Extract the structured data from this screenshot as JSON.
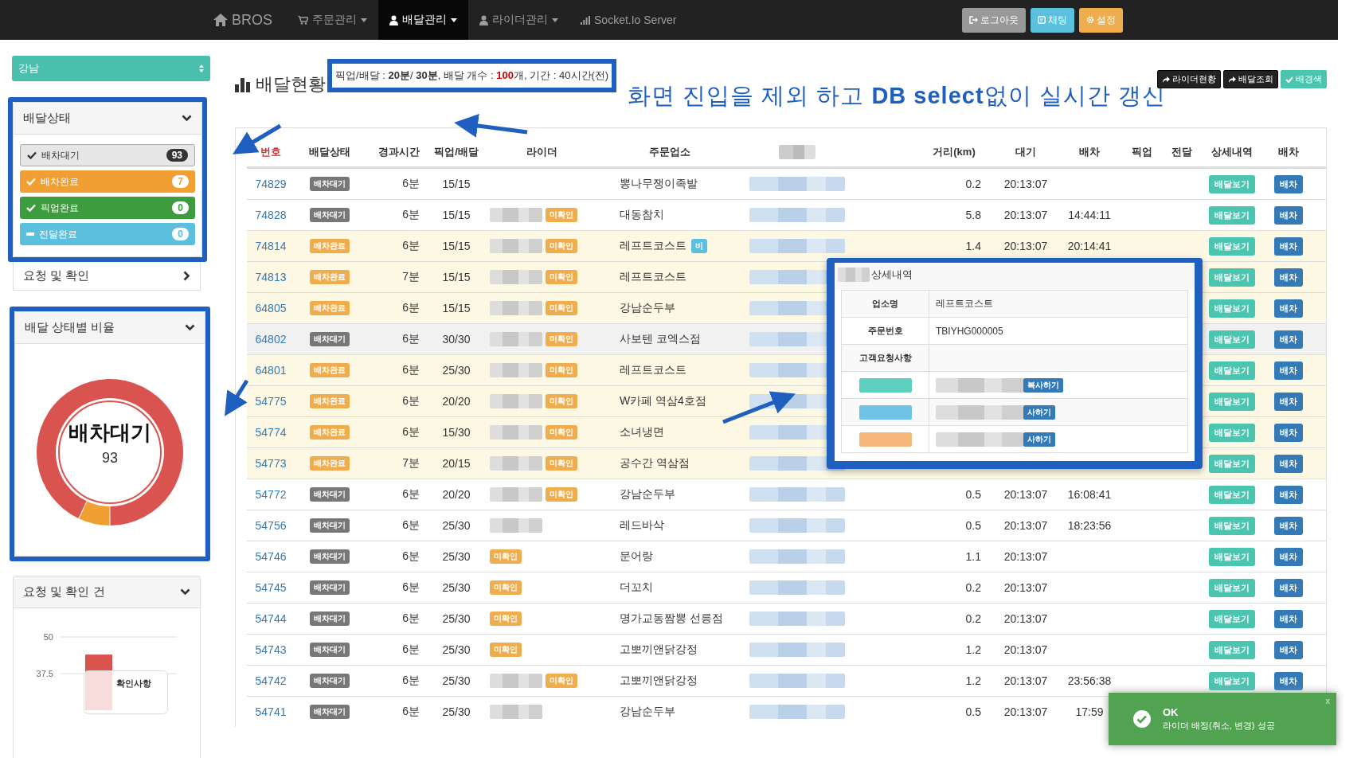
{
  "nav": {
    "brand": "BROS",
    "menus": [
      {
        "label": "주문관리",
        "kind": "orders",
        "dropdown": true,
        "selected": false
      },
      {
        "label": "배달관리",
        "kind": "delivery",
        "dropdown": true,
        "selected": true
      },
      {
        "label": "라이더관리",
        "kind": "riders",
        "dropdown": true,
        "selected": false
      },
      {
        "label": "Socket.Io Server",
        "kind": "socket",
        "dropdown": false,
        "selected": false
      }
    ],
    "buttons": [
      {
        "label": "로그아웃",
        "kind": "logout"
      },
      {
        "label": "채팅",
        "kind": "chat"
      },
      {
        "label": "설정",
        "kind": "settings"
      }
    ]
  },
  "sidebar": {
    "region": "강남",
    "status_panel": {
      "title": "배달상태",
      "expanded": true,
      "items": [
        {
          "label": "배차대기",
          "count": "93",
          "checked": true,
          "color": "#e6e6e6"
        },
        {
          "label": "배차완료",
          "count": "7",
          "checked": true,
          "color": "#f0a033"
        },
        {
          "label": "픽업완료",
          "count": "0",
          "checked": true,
          "color": "#3d9c3d"
        },
        {
          "label": "전달완료",
          "count": "0",
          "checked": false,
          "color": "#5bc0de"
        }
      ]
    },
    "request_row": {
      "title": "요청 및 확인",
      "expanded": false
    },
    "ratio_panel": {
      "title": "배달 상태별 비율",
      "expanded": true,
      "center_label": "배차대기",
      "center_value": "93",
      "chart_data": {
        "type": "donut",
        "values": [
          93,
          7,
          0,
          0
        ]
      }
    },
    "request_panel": {
      "title": "요청 및 확인 건",
      "expanded": true,
      "chart_data": {
        "type": "bar",
        "ylim": [
          25,
          50
        ],
        "yticks": [
          37.5,
          50
        ],
        "series": [
          {
            "name": "확인사항",
            "color": "#d9534f",
            "values": [
              44
            ]
          }
        ]
      }
    }
  },
  "main": {
    "title": "배달현황",
    "info": "픽업/배달 : **20분**/ **30분**,  배달 개수 : **100**개,  기간 : 40시간(전)",
    "annotation": "화면 진입을 제외 하고 **DB select**없이 실시간 갱신",
    "actions": [
      {
        "label": "라이더현황",
        "kind": "link"
      },
      {
        "label": "배달조회",
        "kind": "link"
      },
      {
        "label": "배경색",
        "kind": "toggle"
      }
    ]
  },
  "table": {
    "columns": [
      {
        "label": "번호",
        "sorted": true
      },
      {
        "label": "배달상태",
        "sorted": false
      },
      {
        "label": "경과시간",
        "sorted": false
      },
      {
        "label": "픽업/배달",
        "sorted": false
      },
      {
        "label": "라이더",
        "sorted": false
      },
      {
        "label": "주문업소",
        "sorted": false
      },
      {
        "redacted": true
      },
      {
        "label": "거리(km)",
        "sorted": false
      },
      {
        "label": "대기",
        "sorted": false
      },
      {
        "label": "배차",
        "sorted": false
      },
      {
        "label": "픽업",
        "sorted": false
      },
      {
        "label": "전달",
        "sorted": false
      },
      {
        "label": "상세내역",
        "sorted": false
      },
      {
        "label": "배차",
        "sorted": false
      }
    ],
    "rows": [
      {
        "no": "74829",
        "status": "배차대기",
        "dispatched": false,
        "elapsed": "6분",
        "pickup_delivery": "15/15",
        "rider_redacted": false,
        "store": "뽕나무쟁이족발",
        "distance": "0.2",
        "wait": "20:13:07",
        "detail_button": "배달보기",
        "dispatch_button": "배차",
        "hovered": false
      },
      {
        "no": "74828",
        "status": "배차대기",
        "dispatched": false,
        "elapsed": "6분",
        "pickup_delivery": "15/15",
        "rider_redacted": true,
        "rider_badge": "미확인",
        "store": "대동참치",
        "distance": "5.8",
        "wait": "20:13:07",
        "dispatch_time": "14:44:11",
        "detail_button": "배달보기",
        "dispatch_button": "배차",
        "hovered": false
      },
      {
        "no": "74814",
        "status": "배차완료",
        "dispatched": true,
        "elapsed": "6분",
        "pickup_delivery": "15/15",
        "rider_redacted": true,
        "rider_badge": "미확인",
        "store": "레프트코스트",
        "store_badge": "비",
        "distance": "1.4",
        "wait": "20:13:07",
        "dispatch_time": "20:14:41",
        "detail_button": "배달보기",
        "dispatch_button": "배차",
        "hovered": false
      },
      {
        "no": "74813",
        "status": "배차완료",
        "dispatched": true,
        "elapsed": "7분",
        "pickup_delivery": "15/15",
        "rider_redacted": true,
        "rider_badge": "미확인",
        "store": "레프트코스트",
        "detail_button": "배달보기",
        "dispatch_button": "배차",
        "hovered": false
      },
      {
        "no": "64805",
        "status": "배차완료",
        "dispatched": true,
        "elapsed": "6분",
        "pickup_delivery": "15/15",
        "rider_redacted": true,
        "rider_badge": "미확인",
        "store": "강남순두부",
        "detail_button": "배달보기",
        "dispatch_button": "배차",
        "hovered": false
      },
      {
        "no": "64802",
        "status": "배차대기",
        "dispatched": false,
        "elapsed": "6분",
        "pickup_delivery": "30/30",
        "rider_redacted": true,
        "rider_badge": "미확인",
        "store": "사보텐 코엑스점",
        "detail_button": "배달보기",
        "dispatch_button": "배차",
        "hovered": true
      },
      {
        "no": "64801",
        "status": "배차완료",
        "dispatched": true,
        "elapsed": "6분",
        "pickup_delivery": "25/30",
        "rider_redacted": true,
        "rider_badge": "미확인",
        "store": "레프트코스트",
        "detail_button": "배달보기",
        "dispatch_button": "배차",
        "hovered": false
      },
      {
        "no": "54775",
        "status": "배차완료",
        "dispatched": true,
        "elapsed": "6분",
        "pickup_delivery": "20/20",
        "rider_redacted": true,
        "rider_badge": "미확인",
        "store": "W카페 역삼4호점",
        "detail_button": "배달보기",
        "dispatch_button": "배차",
        "hovered": false
      },
      {
        "no": "54774",
        "status": "배차완료",
        "dispatched": true,
        "elapsed": "6분",
        "pickup_delivery": "15/30",
        "rider_redacted": true,
        "rider_badge": "미확인",
        "store": "소녀냉면",
        "detail_button": "배달보기",
        "dispatch_button": "배차",
        "hovered": false
      },
      {
        "no": "54773",
        "status": "배차완료",
        "dispatched": true,
        "elapsed": "7분",
        "pickup_delivery": "20/15",
        "rider_redacted": true,
        "rider_badge": "미확인",
        "store": "공수간 역삼점",
        "detail_button": "배달보기",
        "dispatch_button": "배차",
        "hovered": false
      },
      {
        "no": "54772",
        "status": "배차대기",
        "dispatched": false,
        "elapsed": "6분",
        "pickup_delivery": "20/20",
        "rider_redacted": true,
        "rider_badge": "미확인",
        "store": "강남순두부",
        "distance": "0.5",
        "wait": "20:13:07",
        "dispatch_time": "16:08:41",
        "detail_button": "배달보기",
        "dispatch_button": "배차",
        "hovered": false
      },
      {
        "no": "54756",
        "status": "배차대기",
        "dispatched": false,
        "elapsed": "6분",
        "pickup_delivery": "25/30",
        "rider_redacted": true,
        "store": "레드바삭",
        "distance": "0.5",
        "wait": "20:13:07",
        "dispatch_time": "18:23:56",
        "detail_button": "배달보기",
        "dispatch_button": "배차",
        "hovered": false
      },
      {
        "no": "54746",
        "status": "배차대기",
        "dispatched": false,
        "elapsed": "6분",
        "pickup_delivery": "25/30",
        "rider_redacted": false,
        "rider_badge": "미확인",
        "store": "문어랑",
        "distance": "1.1",
        "wait": "20:13:07",
        "detail_button": "배달보기",
        "dispatch_button": "배차",
        "hovered": false
      },
      {
        "no": "54745",
        "status": "배차대기",
        "dispatched": false,
        "elapsed": "6분",
        "pickup_delivery": "25/30",
        "rider_redacted": false,
        "rider_badge": "미확인",
        "store": "더꼬치",
        "distance": "0.2",
        "wait": "20:13:07",
        "detail_button": "배달보기",
        "dispatch_button": "배차",
        "hovered": false
      },
      {
        "no": "54744",
        "status": "배차대기",
        "dispatched": false,
        "elapsed": "6분",
        "pickup_delivery": "25/30",
        "rider_redacted": false,
        "rider_badge": "미확인",
        "store": "명가교동짬뽕 선릉점",
        "distance": "0.2",
        "wait": "20:13:07",
        "detail_button": "배달보기",
        "dispatch_button": "배차",
        "hovered": false
      },
      {
        "no": "54743",
        "status": "배차대기",
        "dispatched": false,
        "elapsed": "6분",
        "pickup_delivery": "25/30",
        "rider_redacted": false,
        "rider_badge": "미확인",
        "store": "고뽀끼앤닭강정",
        "distance": "1.2",
        "wait": "20:13:07",
        "detail_button": "배달보기",
        "dispatch_button": "배차",
        "hovered": false
      },
      {
        "no": "54742",
        "status": "배차대기",
        "dispatched": false,
        "elapsed": "6분",
        "pickup_delivery": "25/30",
        "rider_redacted": true,
        "rider_badge": "미확인",
        "store": "고뽀끼앤닭강정",
        "distance": "1.2",
        "wait": "20:13:07",
        "dispatch_time": "23:56:38",
        "detail_button": "배달보기",
        "dispatch_button": "배차",
        "hovered": false
      },
      {
        "no": "54741",
        "status": "배차대기",
        "dispatched": false,
        "elapsed": "6분",
        "pickup_delivery": "25/30",
        "rider_redacted": true,
        "store": "강남순두부",
        "distance": "0.5",
        "wait": "20:13:07",
        "dispatch_time": "17:59",
        "hovered": false
      }
    ]
  },
  "popup": {
    "title": "상세내역",
    "rows": [
      {
        "label": "업소명",
        "value": "레프트코스트"
      },
      {
        "label": "주문번호",
        "value": "TBIYHG000005"
      },
      {
        "label": "고객요청사항"
      }
    ],
    "copy_rows": [
      {
        "color": "#5fcfc0",
        "button": "복사하기"
      },
      {
        "color": "#6cc3e6",
        "button": "사하기"
      },
      {
        "color": "#f5b87a",
        "button": "사하기"
      }
    ]
  },
  "toast": {
    "title": "OK",
    "message": "라이더 배정(취소, 변경) 성공",
    "close": "x"
  }
}
